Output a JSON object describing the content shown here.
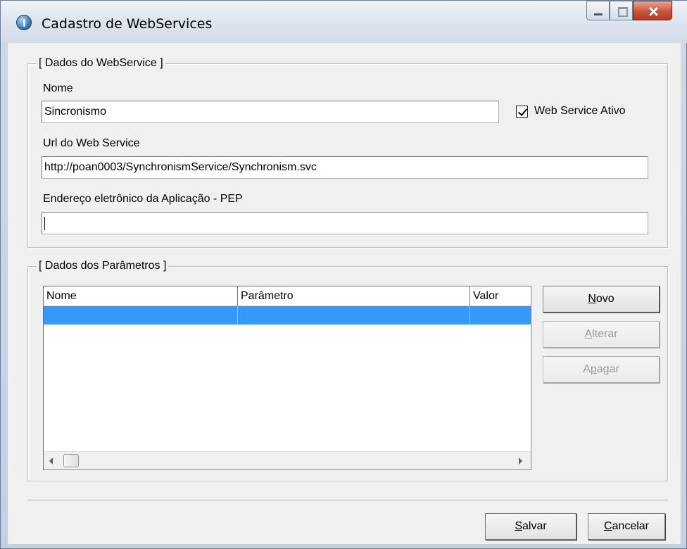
{
  "window": {
    "title": "Cadastro de WebServices"
  },
  "webservice_group": {
    "legend": "[ Dados do WebService ]",
    "name_label": "Nome",
    "name_value": "Sincronismo",
    "active_label": "Web Service Ativo",
    "active_checked": true,
    "url_label": "Url do Web Service",
    "url_value": "http://poan0003/SynchronismService/Synchronism.svc",
    "pep_label": "Endereço eletrônico da Aplicação - PEP",
    "pep_value": ""
  },
  "params_group": {
    "legend": "[ Dados dos Parâmetros ]",
    "columns": [
      "Nome",
      "Parâmetro",
      "Valor"
    ],
    "rows": [
      [
        "",
        "",
        ""
      ]
    ],
    "selected_row": 0
  },
  "buttons": {
    "novo": {
      "underline": "N",
      "rest": "ovo",
      "enabled": true
    },
    "alterar": {
      "underline": "A",
      "rest": "lterar",
      "enabled": false
    },
    "apagar": {
      "pre": "A",
      "underline": "p",
      "rest": "agar",
      "enabled": false
    },
    "salvar": {
      "underline": "S",
      "rest": "alvar",
      "enabled": true
    },
    "cancelar": {
      "underline": "C",
      "rest": "ancelar",
      "enabled": true
    }
  }
}
